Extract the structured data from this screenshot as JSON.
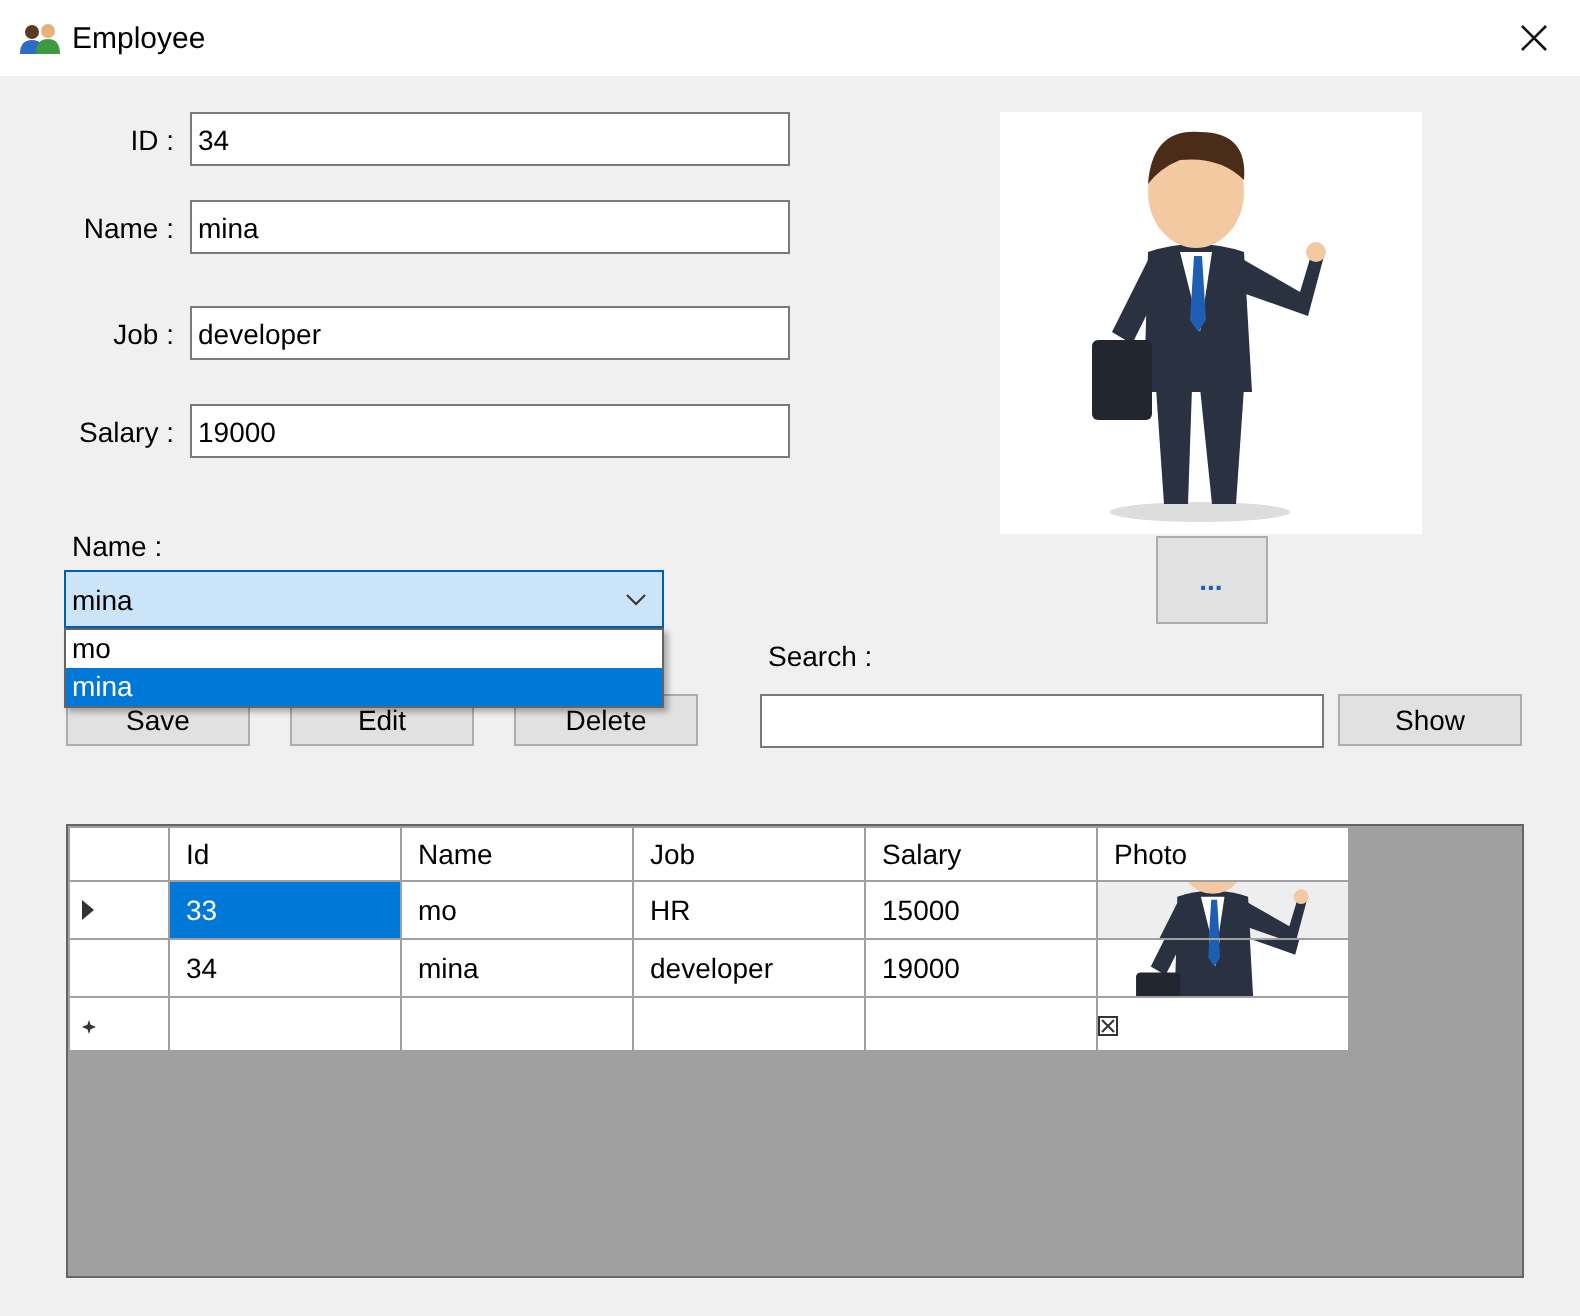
{
  "window": {
    "title": "Employee"
  },
  "fields": [
    {
      "label": "ID :",
      "value": "34"
    },
    {
      "label": "Name :",
      "value": "mina"
    },
    {
      "label": "Job :",
      "value": "developer"
    },
    {
      "label": "Salary :",
      "value": "19000"
    }
  ],
  "photo": {
    "kind": "picture"
  },
  "browse_button": "...",
  "name_combo": {
    "label": "Name :",
    "value": "mina",
    "open": true,
    "options": [
      {
        "label": "mo",
        "selected": false
      },
      {
        "label": "mina",
        "selected": true
      }
    ]
  },
  "buttons": [
    "Save",
    "Edit",
    "Delete"
  ],
  "search": {
    "label": "Search :",
    "button": "Show"
  },
  "grid": {
    "columns": [
      "Id",
      "Name",
      "Job",
      "Salary",
      "Photo"
    ],
    "rows": [
      {
        "kind": "data",
        "current": true,
        "cells": [
          {
            "text": "33",
            "selected": true
          },
          {
            "text": "mo",
            "selected": false
          },
          {
            "text": "HR",
            "selected": false
          },
          {
            "text": "15000",
            "selected": false
          }
        ]
      },
      {
        "kind": "data",
        "current": false,
        "cells": [
          {
            "text": "34",
            "selected": false
          },
          {
            "text": "mina",
            "selected": false
          },
          {
            "text": "developer",
            "selected": false
          },
          {
            "text": "19000",
            "selected": false
          }
        ]
      },
      {
        "kind": "new",
        "current": false
      }
    ]
  }
}
